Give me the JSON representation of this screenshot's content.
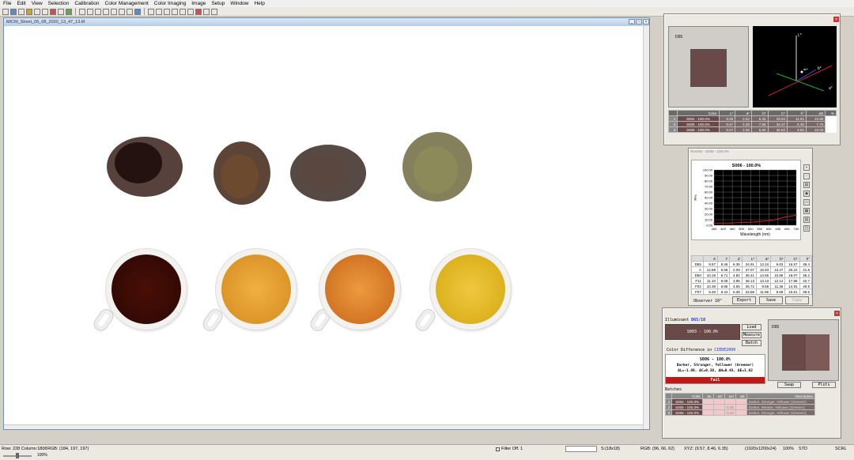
{
  "menu": [
    "File",
    "Edit",
    "View",
    "Selection",
    "Calibration",
    "Color Management",
    "Color Imaging",
    "Image",
    "Setup",
    "Window",
    "Help"
  ],
  "document": {
    "title": "MICM_Sheet_05_08_2020_13_47_13.tif"
  },
  "color_3d_panel": {
    "swatch_label": "D65",
    "axis_labels": {
      "l": "L*",
      "a": "a*",
      "b": "b*",
      "ab": "ab*"
    },
    "table_header": [
      "",
      "Color",
      "L*",
      "a*",
      "b*",
      "C*",
      "h°",
      "ΔE",
      "%"
    ],
    "rows": [
      {
        "id": "1",
        "name": "S004 - 100.0%",
        "vals": [
          "9.90",
          "2.62",
          "5.45",
          "28.53",
          "11.94",
          "10.66"
        ]
      },
      {
        "id": "2",
        "name": "S005 - 100.0%",
        "vals": [
          "9.67",
          "4.39",
          "7.88",
          "36.37",
          "6.48",
          "7.75"
        ]
      },
      {
        "id": "3",
        "name": "S006 - 100.0%",
        "vals": [
          "9.57",
          "4.36",
          "6.66",
          "35.92",
          "9.55",
          "20.00"
        ]
      }
    ]
  },
  "results_panel": {
    "title": "Results - S006 - 100.0%",
    "chart_title": "S006 - 100.0%",
    "ylabel": "R%",
    "xlabel": "Wavelength (nm)",
    "y_ticks": [
      "100.00",
      "90.00",
      "80.00",
      "70.00",
      "60.00",
      "50.00",
      "40.00",
      "30.00",
      "20.00",
      "10.00",
      "0.00"
    ],
    "x_ticks": [
      "400",
      "420",
      "460",
      "500",
      "520",
      "550",
      "600",
      "630",
      "660",
      "700"
    ],
    "table_header": [
      "",
      "X",
      "Y",
      "Z",
      "L*",
      "a*",
      "b*",
      "C*",
      "h°"
    ],
    "table_rows": [
      [
        "D65",
        "9.57",
        "8.46",
        "6.35",
        "34.91",
        "13.34",
        "9.63",
        "16.57",
        "36.4"
      ],
      [
        "A",
        "12.88",
        "9.58",
        "2.09",
        "37.07",
        "15.83",
        "13.47",
        "20.22",
        "41.8"
      ],
      [
        "D50",
        "10.19",
        "8.71",
        "4.82",
        "35.41",
        "14.55",
        "10.68",
        "18.07",
        "36.2"
      ],
      [
        "F11",
        "11.10",
        "9.08",
        "3.95",
        "36.13",
        "13.13",
        "12.14",
        "17.88",
        "42.7"
      ],
      [
        "F02",
        "10.39",
        "8.86",
        "4.06",
        "35.72",
        "9.55",
        "11.36",
        "14.91",
        "49.9"
      ],
      [
        "F07",
        "9.48",
        "8.44",
        "6.39",
        "34.88",
        "11.96",
        "9.58",
        "15.51",
        "39.5"
      ]
    ],
    "observer": "Observer 10°",
    "export_label": "Export",
    "save_label": "Save",
    "copy_label": "Copy"
  },
  "chart_data": {
    "type": "line",
    "title": "S006 - 100.0%",
    "xlabel": "Wavelength (nm)",
    "ylabel": "R%",
    "xlim": [
      400,
      700
    ],
    "ylim": [
      0,
      100
    ],
    "series": [
      {
        "name": "S006 - 100.0%",
        "color": "#cc2020",
        "x": [
          400,
          420,
          460,
          500,
          520,
          550,
          600,
          630,
          660,
          700
        ],
        "y": [
          4,
          4,
          4,
          5,
          5,
          6,
          8,
          11,
          15,
          18
        ]
      }
    ]
  },
  "compare_panel": {
    "illuminant_label": "Illuminant",
    "illuminant_value": "D65/10",
    "standard_name": "S003 - 100.0%",
    "load_label": "Load",
    "measure_label": "Measure",
    "batch_label": "Batch",
    "diff_label": "Color Difference in",
    "diff_method": "CIEDE2000",
    "sample_name": "S006 - 100.0%",
    "description": "Darker, Stronger, Yellower (Greener)",
    "deltas": "ΔL=-1.69, ΔC=0.38, ΔH=0.43, ΔE=1.82",
    "result": "Fail",
    "swatch_label": "D65",
    "swap_label": "Swap",
    "plots_label": "Plots",
    "batches_label": "Batches",
    "batch_header": [
      "",
      "Color",
      "ΔL",
      "ΔC",
      "ΔH",
      "ΔE",
      "Description"
    ],
    "batch_rows": [
      {
        "id": "1",
        "name": "S004 - 100.0%",
        "vals": [
          "",
          "",
          "",
          ""
        ],
        "desc": "Darker, Stronger, Yellower (Greener)"
      },
      {
        "id": "2",
        "name": "S005 - 100.0%",
        "vals": [
          "",
          "",
          "0.49",
          ""
        ],
        "desc": "Darker, Weaker, Yellower (Greener)"
      },
      {
        "id": "3",
        "name": "S006 - 100.0%",
        "vals": [
          "",
          "",
          "0.43",
          ""
        ],
        "desc": "Darker, Stronger, Yellower (Greener)"
      }
    ]
  },
  "status": {
    "position": "Row: 228 Column:1808",
    "rgb": "RGB: (184, 197, 197)",
    "filter": "Filter Off. 1",
    "sample": "S:(18x18)",
    "rgb_sample": "RGB: (96, 66, 62)",
    "xyz": "XYZ: (9.57, 8.46, 6.35)",
    "dims": "(1920x1200x24)",
    "zoom": "100%",
    "mode": "STD",
    "scrl": "SCRL",
    "slider": "100%"
  },
  "colors": {
    "swatch": "#6a4a48",
    "swatch_light": "#7b5a57",
    "fail": "#c01818"
  }
}
